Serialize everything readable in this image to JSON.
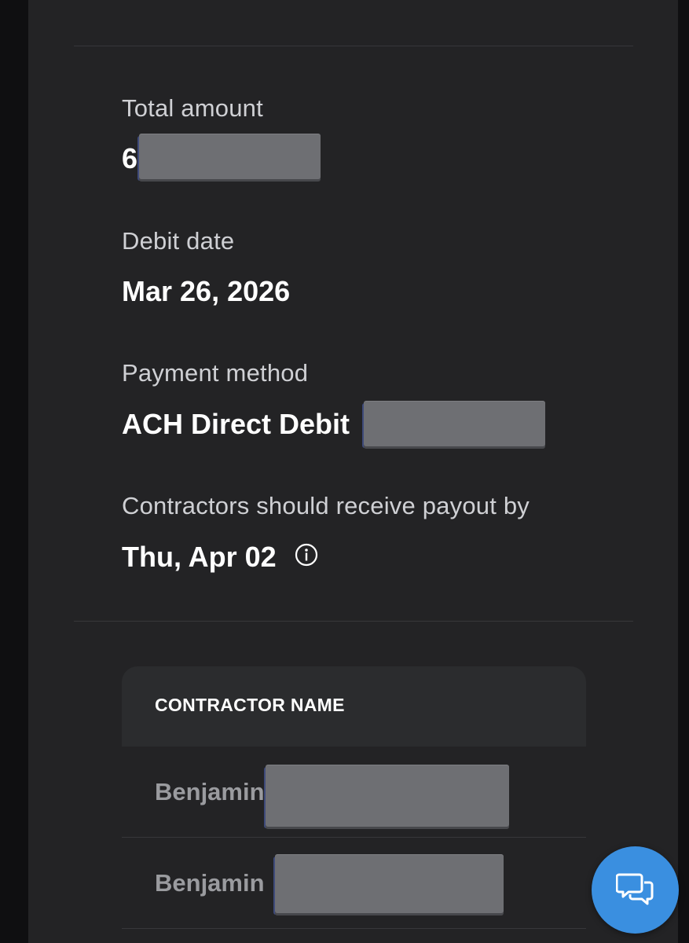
{
  "summary": {
    "total_amount_label": "Total amount",
    "total_amount_value": "6",
    "debit_date_label": "Debit date",
    "debit_date_value": "Mar 26, 2026",
    "payment_method_label": "Payment method",
    "payment_method_value": "ACH Direct Debit",
    "payout_label": "Contractors should receive payout by",
    "payout_value": "Thu, Apr 02"
  },
  "table": {
    "header": "CONTRACTOR NAME",
    "rows": [
      {
        "name": "Benjamin"
      },
      {
        "name": "Benjamin"
      }
    ]
  },
  "icons": {
    "info": "info-circle-icon",
    "chat": "chat-bubbles-icon"
  },
  "colors": {
    "panel_bg": "#232325",
    "chat_button": "#3a8fe0",
    "redaction": "#6e6f73"
  }
}
